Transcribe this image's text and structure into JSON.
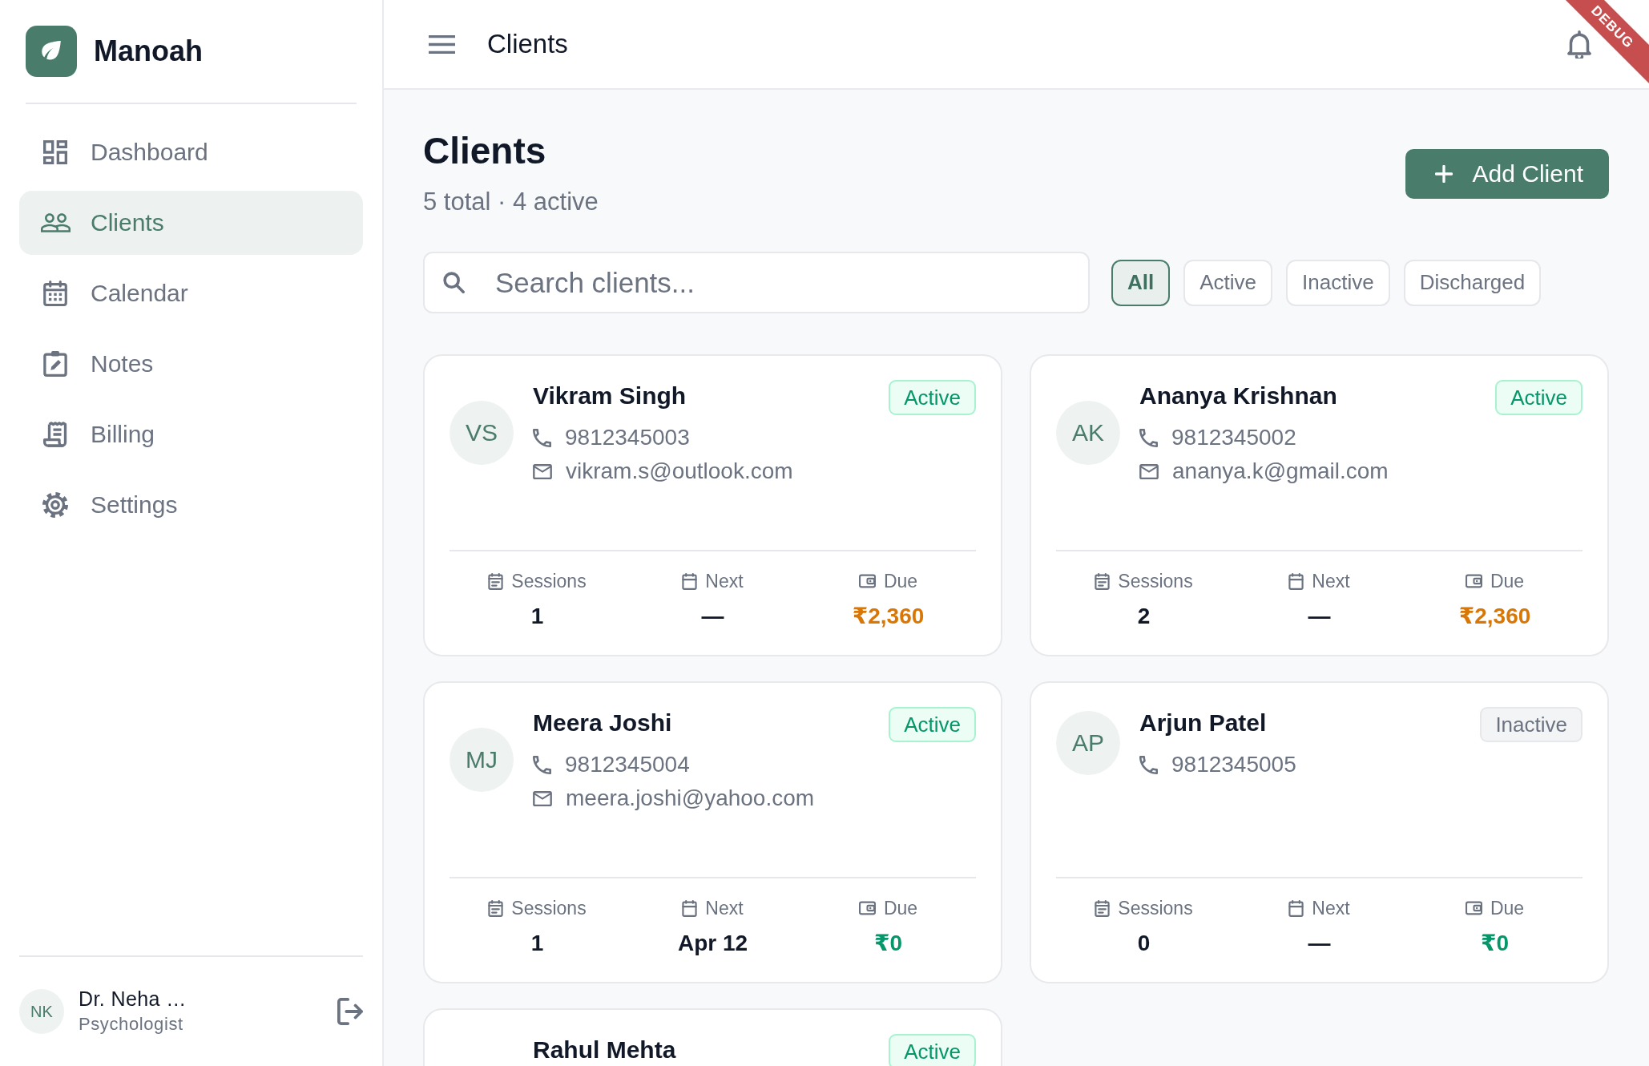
{
  "sidebar": {
    "brand": "Manoah",
    "nav": [
      {
        "label": "Dashboard",
        "selected": false
      },
      {
        "label": "Clients",
        "selected": true
      },
      {
        "label": "Calendar",
        "selected": false
      },
      {
        "label": "Notes",
        "selected": false
      },
      {
        "label": "Billing",
        "selected": false
      },
      {
        "label": "Settings",
        "selected": false
      }
    ],
    "user": {
      "initials": "NK",
      "name": "Dr. Neha …",
      "role": "Psychologist"
    }
  },
  "top_bar": {
    "title": "Clients"
  },
  "debug_banner": {
    "label": "DEBUG"
  },
  "page_header": {
    "title": "Clients",
    "subtitle": "5 total · 4 active",
    "add_button": "Add Client"
  },
  "search": {
    "placeholder": "Search clients..."
  },
  "filters": [
    {
      "label": "All",
      "selected": true
    },
    {
      "label": "Active",
      "selected": false
    },
    {
      "label": "Inactive",
      "selected": false
    },
    {
      "label": "Discharged",
      "selected": false
    }
  ],
  "clients": [
    {
      "initials": "VS",
      "name": "Vikram Singh",
      "phone": "9812345003",
      "email": "vikram.s@outlook.com",
      "status": {
        "label": "Active",
        "kind": "active"
      },
      "stats": [
        {
          "kind": "sessions",
          "label": "Sessions",
          "value": "1"
        },
        {
          "kind": "next",
          "label": "Next",
          "value": "—"
        },
        {
          "kind": "due",
          "label": "Due",
          "value": "₹2,360",
          "outstanding": true
        }
      ]
    },
    {
      "initials": "AK",
      "name": "Ananya Krishnan",
      "phone": "9812345002",
      "email": "ananya.k@gmail.com",
      "status": {
        "label": "Active",
        "kind": "active"
      },
      "stats": [
        {
          "kind": "sessions",
          "label": "Sessions",
          "value": "2"
        },
        {
          "kind": "next",
          "label": "Next",
          "value": "—"
        },
        {
          "kind": "due",
          "label": "Due",
          "value": "₹2,360",
          "outstanding": true
        }
      ]
    },
    {
      "initials": "MJ",
      "name": "Meera Joshi",
      "phone": "9812345004",
      "email": "meera.joshi@yahoo.com",
      "status": {
        "label": "Active",
        "kind": "active"
      },
      "stats": [
        {
          "kind": "sessions",
          "label": "Sessions",
          "value": "1"
        },
        {
          "kind": "next",
          "label": "Next",
          "value": "Apr 12"
        },
        {
          "kind": "due",
          "label": "Due",
          "value": "₹0",
          "outstanding": false
        }
      ]
    },
    {
      "initials": "AP",
      "name": "Arjun Patel",
      "phone": "9812345005",
      "status": {
        "label": "Inactive",
        "kind": "inactive"
      },
      "stats": [
        {
          "kind": "sessions",
          "label": "Sessions",
          "value": "0"
        },
        {
          "kind": "next",
          "label": "Next",
          "value": "—"
        },
        {
          "kind": "due",
          "label": "Due",
          "value": "₹0",
          "outstanding": false
        }
      ]
    },
    {
      "name": "Rahul Mehta",
      "status": {
        "label": "Active",
        "kind": "active"
      }
    }
  ]
}
